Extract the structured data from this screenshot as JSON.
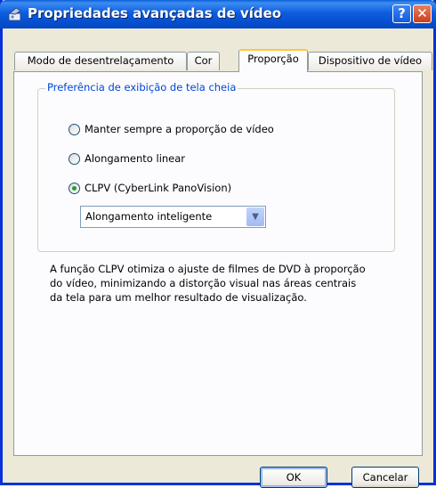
{
  "window": {
    "title": "Propriedades avançadas de vídeo",
    "help_label": "?",
    "close_label": "✕"
  },
  "tabs": [
    {
      "label": "Modo de desentrelaçamento",
      "active": false
    },
    {
      "label": "Cor",
      "active": false
    },
    {
      "label": "Proporção",
      "active": true
    },
    {
      "label": "Dispositivo de vídeo",
      "active": false
    }
  ],
  "group": {
    "label": "Preferência de exibição de tela cheia",
    "options": [
      {
        "label": "Manter sempre a proporção de vídeo",
        "checked": false
      },
      {
        "label": "Alongamento linear",
        "checked": false
      },
      {
        "label": "CLPV (CyberLink PanoVision)",
        "checked": true
      }
    ],
    "dropdown_value": "Alongamento inteligente"
  },
  "description": "A função CLPV otimiza o ajuste de filmes de DVD à proporção do vídeo, minimizando a distorção visual nas áreas centrais da tela para um melhor resultado de visualização.",
  "buttons": {
    "ok": "OK",
    "cancel": "Cancelar"
  },
  "colors": {
    "titlebar": "#0a5fd8",
    "group_label": "#0046d5",
    "radio_dot": "#21a121",
    "active_tab_accent": "#ffc83c"
  }
}
